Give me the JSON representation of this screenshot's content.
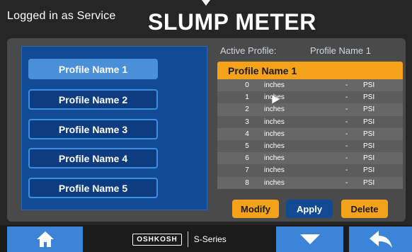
{
  "header": {
    "login_status": "Logged in as Service",
    "title": "SLUMP METER"
  },
  "profiles": [
    {
      "label": "Profile Name 1",
      "selected": true
    },
    {
      "label": "Profile Name 2",
      "selected": false
    },
    {
      "label": "Profile Name 3",
      "selected": false
    },
    {
      "label": "Profile Name 4",
      "selected": false
    },
    {
      "label": "Profile Name 5",
      "selected": false
    }
  ],
  "active_profile": {
    "label": "Active Profile:",
    "value": "Profile Name 1"
  },
  "table": {
    "header": "Profile Name 1",
    "rows": [
      {
        "index": "0",
        "unit": "inches",
        "value": "-",
        "pressure_unit": "PSI"
      },
      {
        "index": "1",
        "unit": "inches",
        "value": "-",
        "pressure_unit": "PSI"
      },
      {
        "index": "2",
        "unit": "inches",
        "value": "-",
        "pressure_unit": "PSI"
      },
      {
        "index": "3",
        "unit": "inches",
        "value": "-",
        "pressure_unit": "PSI"
      },
      {
        "index": "4",
        "unit": "inches",
        "value": "-",
        "pressure_unit": "PSI"
      },
      {
        "index": "5",
        "unit": "inches",
        "value": "-",
        "pressure_unit": "PSI"
      },
      {
        "index": "6",
        "unit": "inches",
        "value": "-",
        "pressure_unit": "PSI"
      },
      {
        "index": "7",
        "unit": "inches",
        "value": "-",
        "pressure_unit": "PSI"
      },
      {
        "index": "8",
        "unit": "inches",
        "value": "-",
        "pressure_unit": "PSI"
      }
    ]
  },
  "actions": {
    "modify": "Modify",
    "apply": "Apply",
    "delete": "Delete"
  },
  "footer": {
    "brand": "OSHKOSH",
    "series": "S-Series",
    "home_icon": "home-icon",
    "down_icon": "chevron-down-icon",
    "back_icon": "back-arrow-icon"
  },
  "colors": {
    "accent_orange": "#f3a21a",
    "nav_blue": "#3b84d7",
    "panel_blue": "#134a95",
    "selected_blue": "#4a90d8"
  }
}
